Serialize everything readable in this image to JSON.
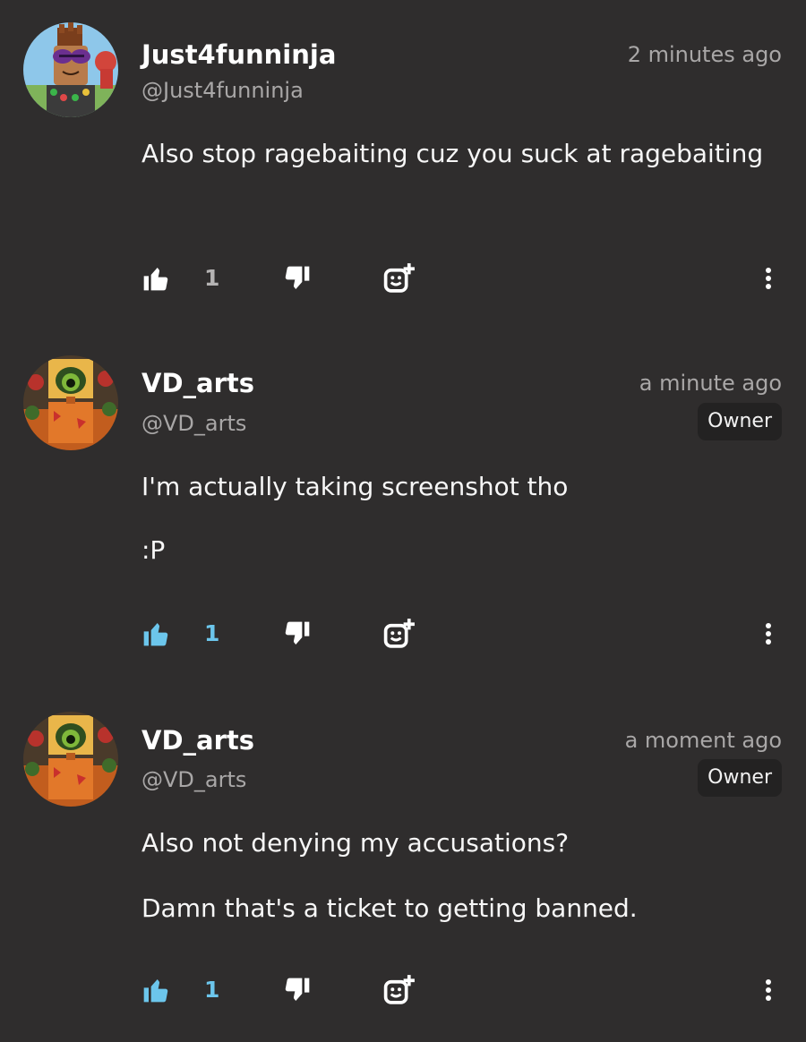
{
  "colors": {
    "background": "#2f2d2d",
    "text_primary": "#ffffff",
    "text_secondary": "#a9a7a7",
    "like_active": "#6cc6ec",
    "like_inactive": "#b5b3b3",
    "badge_bg": "#232222"
  },
  "comments": [
    {
      "username": "Just4funninja",
      "handle": "@Just4funninja",
      "time": "2 minutes ago",
      "badge": "",
      "body": [
        "Also stop ragebaiting cuz you suck at ragebaiting"
      ],
      "likes": "1",
      "liked": false,
      "icons": [
        "thumbs-up-icon",
        "thumbs-down-icon",
        "add-reaction-icon",
        "more-vertical-icon"
      ]
    },
    {
      "username": "VD_arts",
      "handle": "@VD_arts",
      "time": "a minute ago",
      "badge": "Owner",
      "body": [
        "I'm actually taking screenshot tho",
        ":P"
      ],
      "likes": "1",
      "liked": true,
      "icons": [
        "thumbs-up-icon",
        "thumbs-down-icon",
        "add-reaction-icon",
        "more-vertical-icon"
      ]
    },
    {
      "username": "VD_arts",
      "handle": "@VD_arts",
      "time": "a moment ago",
      "badge": "Owner",
      "body": [
        "Also not denying my accusations?",
        "Damn that's a ticket to getting banned."
      ],
      "likes": "1",
      "liked": true,
      "icons": [
        "thumbs-up-icon",
        "thumbs-down-icon",
        "add-reaction-icon",
        "more-vertical-icon"
      ]
    }
  ]
}
